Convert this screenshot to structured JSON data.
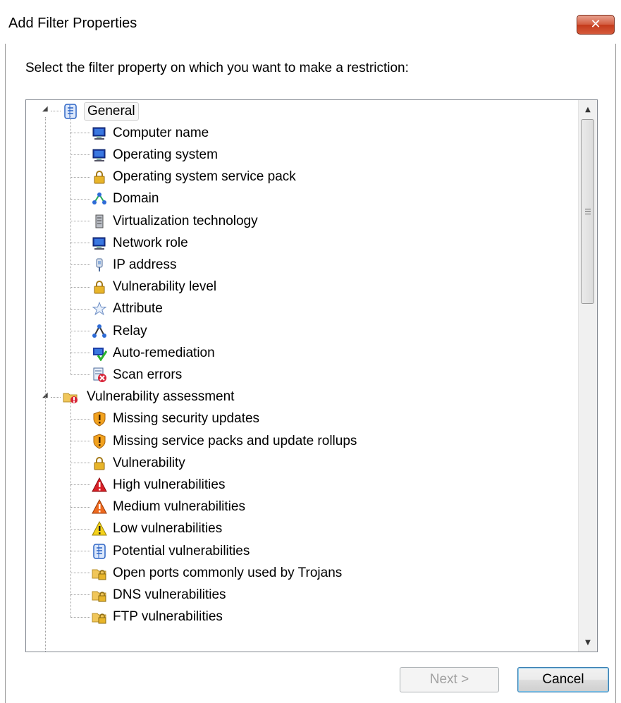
{
  "window": {
    "title": "Add Filter Properties",
    "close_glyph": "✕"
  },
  "instruction": "Select the filter property on which you want to make a restriction:",
  "tree": {
    "groups": [
      {
        "label": "General",
        "icon": "list-icon",
        "expanded": true,
        "selected": true,
        "items": [
          {
            "label": "Computer name",
            "icon": "computer-icon"
          },
          {
            "label": "Operating system",
            "icon": "computer-icon"
          },
          {
            "label": "Operating system service pack",
            "icon": "lock-icon"
          },
          {
            "label": "Domain",
            "icon": "network-icon"
          },
          {
            "label": "Virtualization technology",
            "icon": "server-icon"
          },
          {
            "label": "Network role",
            "icon": "computer-icon"
          },
          {
            "label": "IP address",
            "icon": "ip-plug-icon"
          },
          {
            "label": "Vulnerability level",
            "icon": "lock-icon"
          },
          {
            "label": "Attribute",
            "icon": "star-icon"
          },
          {
            "label": "Relay",
            "icon": "relay-icon"
          },
          {
            "label": "Auto-remediation",
            "icon": "remediation-icon"
          },
          {
            "label": "Scan errors",
            "icon": "scan-error-icon"
          }
        ]
      },
      {
        "label": "Vulnerability assessment",
        "icon": "folder-alert-icon",
        "expanded": true,
        "selected": false,
        "items": [
          {
            "label": "Missing security updates",
            "icon": "shield-warning-icon"
          },
          {
            "label": "Missing service packs and update rollups",
            "icon": "shield-warning-icon"
          },
          {
            "label": "Vulnerability",
            "icon": "lock-icon"
          },
          {
            "label": "High vulnerabilities",
            "icon": "high-warning-icon"
          },
          {
            "label": "Medium vulnerabilities",
            "icon": "medium-warning-icon"
          },
          {
            "label": "Low vulnerabilities",
            "icon": "low-warning-icon"
          },
          {
            "label": "Potential vulnerabilities",
            "icon": "list-icon"
          },
          {
            "label": "Open ports commonly used by Trojans",
            "icon": "folder-lock-icon"
          },
          {
            "label": "DNS vulnerabilities",
            "icon": "folder-lock-icon"
          },
          {
            "label": "FTP vulnerabilities",
            "icon": "folder-lock-icon"
          }
        ]
      }
    ],
    "expander_glyph": "◢"
  },
  "scrollbar": {
    "up_glyph": "▲",
    "down_glyph": "▼"
  },
  "buttons": {
    "next": "Next >",
    "cancel": "Cancel"
  },
  "colors": {
    "close_red": "#c43a1b",
    "tree_border": "#828790",
    "primary_button_border": "#3c7fb1"
  }
}
